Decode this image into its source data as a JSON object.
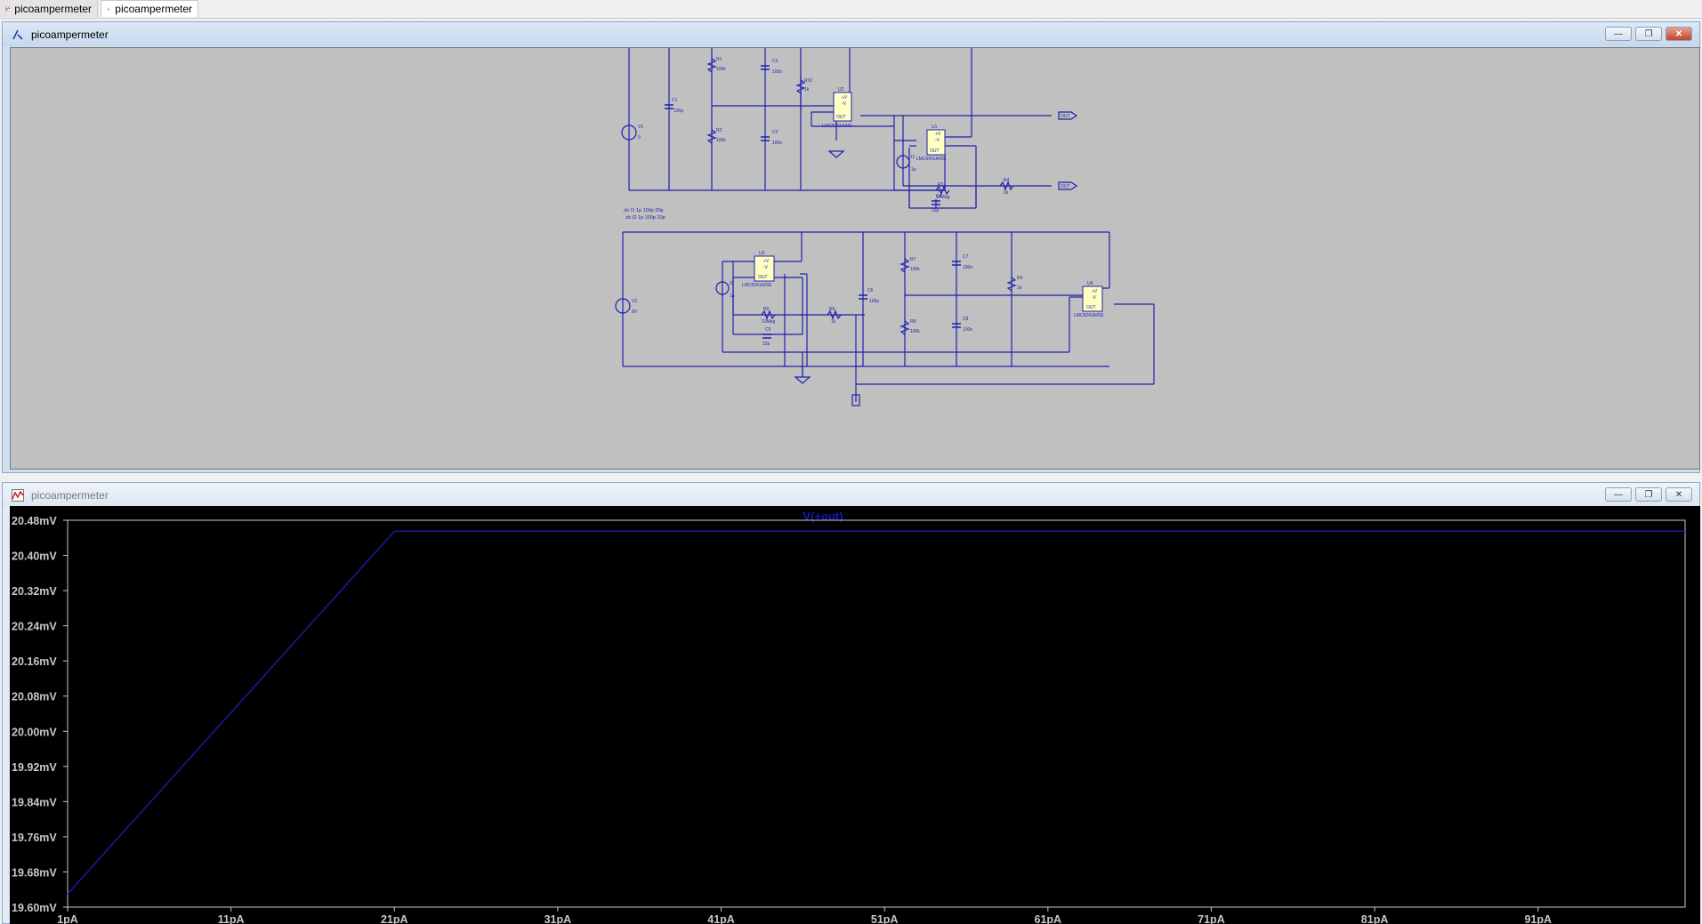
{
  "tabs": [
    {
      "label": "picoampermeter",
      "icon": "waveform-icon"
    },
    {
      "label": "picoampermeter",
      "icon": "schematic-icon"
    }
  ],
  "schematic_window": {
    "title": "picoampermeter",
    "components": {
      "V1": "V1",
      "V1_val": "9",
      "C1": "C1",
      "C1_val": "100p",
      "R1": "R1",
      "R1_val": "100k",
      "R2": "R2",
      "R2_val": "100k",
      "C2": "C2",
      "C2_val": "100n",
      "C3": "C3",
      "C3_val": "100n",
      "R10": "R10",
      "R10_val": "1k",
      "U2": "U2",
      "U2_part": "LMC6041A/NS",
      "U1": "U1",
      "U1_part": "LMC6041A/NS",
      "I1": "I1",
      "I1_val": "1p",
      "R3": "R3",
      "R3_val": "10Meg",
      "R4": "R4",
      "R4_val": "1k",
      "C4": "C4",
      "C4_val": "22p",
      "out_flag": "OUT",
      "V2": "V2",
      "V2_val": "9V",
      "U3": "U3",
      "U3_part": "LMC6041A/NS",
      "I2": "I2",
      "I2_val": "1p",
      "R5": "R5",
      "R5_val": "10Meg",
      "C5": "C5",
      "C5_val": "22p",
      "R6": "R6",
      "R6_val": "1k",
      "C6": "C6",
      "C6_val": "100p",
      "R7": "R7",
      "R7_val": "100k",
      "R8": "R8",
      "R8_val": "100k",
      "C7": "C7",
      "C7_val": "100n",
      "C8": "C8",
      "C8_val": "100n",
      "R9": "R9",
      "R9_val": "1k",
      "U4": "U4",
      "U4_part": "LMC6041A/NS",
      "opamp_plus": "+V",
      "opamp_minus": "-V",
      "opamp_out": "OUT"
    },
    "directives": [
      ".dc I1 1p 100p 20p",
      ".dc I2 1p 100p 20p"
    ]
  },
  "plot_window": {
    "title": "picoampermeter",
    "trace_label": "V(+out)",
    "colors": {
      "trace": "#1a1aa6",
      "title": "#1818c0",
      "background": "#000000",
      "axis": "#c8c8c8"
    }
  },
  "chart_data": {
    "type": "line",
    "title": "V(+out)",
    "xlabel": "",
    "ylabel": "",
    "x_ticks": [
      "1pA",
      "11pA",
      "21pA",
      "31pA",
      "41pA",
      "51pA",
      "61pA",
      "71pA",
      "81pA",
      "91pA"
    ],
    "y_ticks": [
      "20.48mV",
      "20.40mV",
      "20.32mV",
      "20.24mV",
      "20.16mV",
      "20.08mV",
      "20.00mV",
      "19.92mV",
      "19.84mV",
      "19.76mV",
      "19.68mV",
      "19.60mV"
    ],
    "xlim": [
      1,
      100
    ],
    "ylim": [
      19.6,
      20.48
    ],
    "series": [
      {
        "name": "V(+out)",
        "x": [
          1,
          21,
          100
        ],
        "y": [
          19.63,
          20.455,
          20.455
        ]
      }
    ],
    "grid": false
  }
}
